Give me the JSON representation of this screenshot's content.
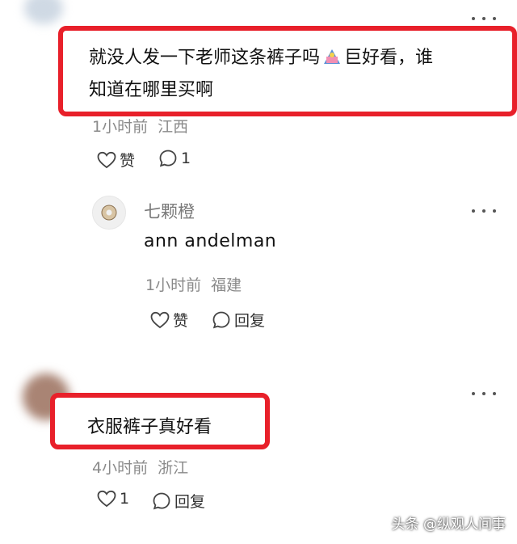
{
  "comment1": {
    "text_line1": "就没人发一下老师这条裤子吗",
    "emoji": "emoji-icon",
    "text_line1_cont": "巨好看，谁",
    "text_line2": "知道在哪里买啊",
    "time": "1小时前",
    "location": "江西",
    "like_label": "赞",
    "reply_count": "1"
  },
  "reply1": {
    "username": "七颗橙",
    "text": "ann andelman",
    "time": "1小时前",
    "location": "福建",
    "like_label": "赞",
    "reply_label": "回复"
  },
  "comment2": {
    "text": "衣服裤子真好看",
    "time": "4小时前",
    "location": "浙江",
    "like_count": "1",
    "reply_label": "回复"
  },
  "watermark": "头条 @纵观人间事",
  "colors": {
    "highlight": "#e8202a",
    "meta": "#8a8a8a"
  }
}
